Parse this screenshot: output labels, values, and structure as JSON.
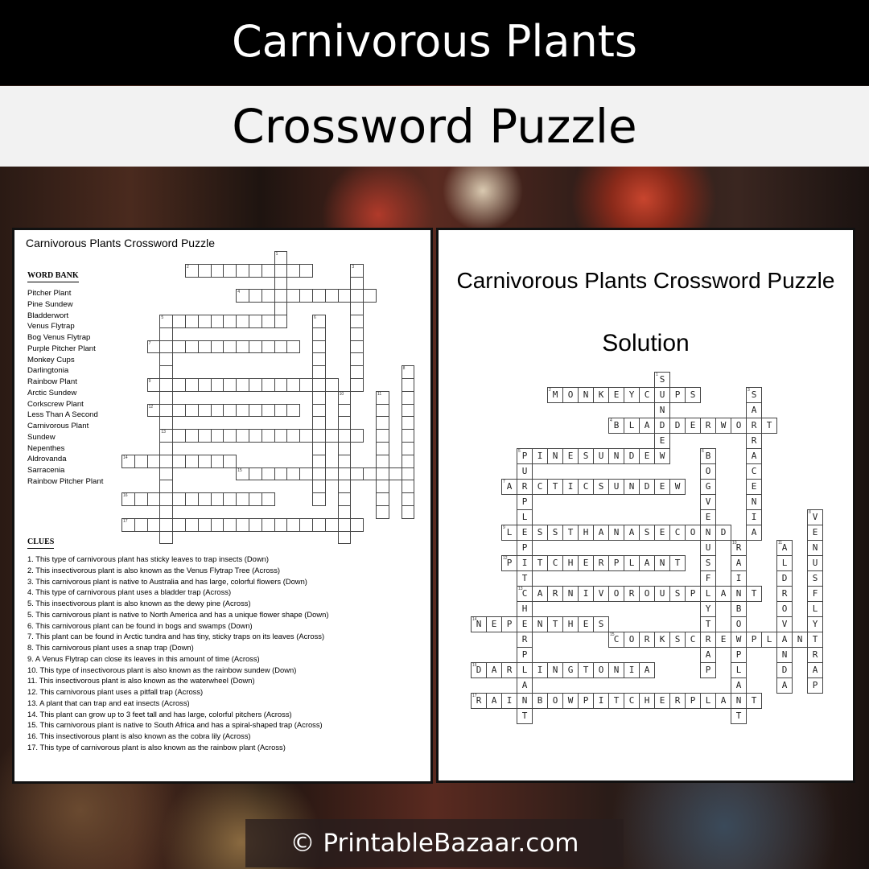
{
  "header": {
    "title": "Carnivorous Plants",
    "subtitle": "Crossword Puzzle"
  },
  "puzzle": {
    "title": "Carnivorous Plants Crossword Puzzle",
    "word_bank_heading": "WORD BANK",
    "word_bank": [
      "Pitcher Plant",
      "Pine Sundew",
      "Bladderwort",
      "Venus Flytrap",
      "Bog Venus Flytrap",
      "Purple Pitcher Plant",
      "Monkey Cups",
      "Darlingtonia",
      "Rainbow Plant",
      "Arctic Sundew",
      "Corkscrew Plant",
      "Less Than A Second",
      "Carnivorous Plant",
      "Sundew",
      "Nepenthes",
      "Aldrovanda",
      "Sarracenia",
      "Rainbow Pitcher Plant"
    ],
    "clues_heading": "CLUES",
    "clues": [
      "1. This type of carnivorous plant has sticky leaves to trap insects (Down)",
      "2. This insectivorous plant is also known as the Venus Flytrap Tree (Across)",
      "3. This carnivorous plant is native to Australia and has large, colorful flowers (Down)",
      "4. This type of carnivorous plant uses a bladder trap (Across)",
      "5. This insectivorous plant is also known as the dewy pine (Across)",
      "5. This carnivorous plant is native to North America and has a unique flower shape (Down)",
      "6. This carnivorous plant can be found in bogs and swamps (Down)",
      "7. This plant can be found in Arctic tundra and has tiny, sticky traps on its leaves (Across)",
      "8. This carnivorous plant uses a snap trap (Down)",
      "9. A Venus Flytrap can close its leaves in this amount of time (Across)",
      "10. This type of insectivorous plant is also known as the rainbow sundew (Down)",
      "11. This insectivorous plant is also known as the waterwheel (Down)",
      "12. This carnivorous plant uses a pitfall trap (Across)",
      "13. A plant that can trap and eat insects (Across)",
      "14. This plant can grow up to 3 feet tall and has large, colorful pitchers (Across)",
      "15. This carnivorous plant is native to South Africa and has a spiral-shaped trap (Across)",
      "16. This insectivorous plant is also known as the cobra lily (Across)",
      "17. This type of carnivorous plant is also known as the rainbow plant (Across)"
    ]
  },
  "solution": {
    "title": "Carnivorous Plants Crossword Puzzle",
    "subtitle": "Solution"
  },
  "crossword": [
    {
      "n": 1,
      "dir": "down",
      "row": 0,
      "col": 12,
      "answer": "SUNDEW"
    },
    {
      "n": 2,
      "dir": "across",
      "row": 1,
      "col": 5,
      "answer": "MONKEYCUPS"
    },
    {
      "n": 3,
      "dir": "down",
      "row": 1,
      "col": 18,
      "answer": "SARRACENIA"
    },
    {
      "n": 4,
      "dir": "across",
      "row": 3,
      "col": 9,
      "answer": "BLADDERWORT"
    },
    {
      "n": 5,
      "dir": "across",
      "row": 5,
      "col": 3,
      "answer": "PINESUNDEW"
    },
    {
      "n": 5,
      "dir": "down",
      "row": 5,
      "col": 3,
      "answer": "PURPLEPITCHERPLANT"
    },
    {
      "n": 6,
      "dir": "down",
      "row": 5,
      "col": 15,
      "answer": "BOGVENUSFLYTRAP"
    },
    {
      "n": 7,
      "dir": "across",
      "row": 7,
      "col": 2,
      "answer": "ARCTICSUNDEW"
    },
    {
      "n": 8,
      "dir": "down",
      "row": 9,
      "col": 22,
      "answer": "VENUSFLYTRAP"
    },
    {
      "n": 9,
      "dir": "across",
      "row": 10,
      "col": 2,
      "answer": "LESSTHANASECOND"
    },
    {
      "n": 10,
      "dir": "down",
      "row": 11,
      "col": 17,
      "answer": "RAINBOWPLANT"
    },
    {
      "n": 11,
      "dir": "down",
      "row": 11,
      "col": 20,
      "answer": "ALDROVANDA"
    },
    {
      "n": 12,
      "dir": "across",
      "row": 12,
      "col": 2,
      "answer": "PITCHERPLANT"
    },
    {
      "n": 13,
      "dir": "across",
      "row": 14,
      "col": 3,
      "answer": "CARNIVOROUSPLANT"
    },
    {
      "n": 14,
      "dir": "across",
      "row": 16,
      "col": 0,
      "answer": "NEPENTHES"
    },
    {
      "n": 15,
      "dir": "across",
      "row": 17,
      "col": 9,
      "answer": "CORKSCREWPLANT"
    },
    {
      "n": 16,
      "dir": "across",
      "row": 19,
      "col": 0,
      "answer": "DARLINGTONIA"
    },
    {
      "n": 17,
      "dir": "across",
      "row": 21,
      "col": 0,
      "answer": "RAINBOWPITCHERPLANT"
    }
  ],
  "footer": {
    "text": "© PrintableBazaar.com"
  }
}
